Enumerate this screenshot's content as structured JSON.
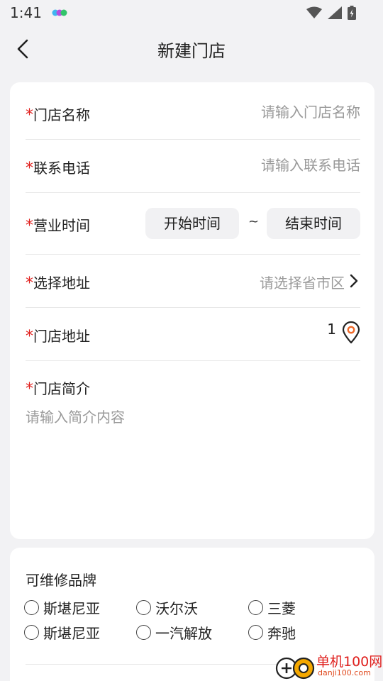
{
  "status_bar": {
    "time": "1:41"
  },
  "header": {
    "title": "新建门店",
    "back_icon": "chevron-left-icon"
  },
  "form": {
    "required_mark": "*",
    "store_name": {
      "label": "门店名称",
      "placeholder": "请输入门店名称",
      "value": ""
    },
    "phone": {
      "label": "联系电话",
      "placeholder": "请输入联系电话",
      "value": ""
    },
    "hours": {
      "label": "营业时间",
      "start": "开始时间",
      "separator": "~",
      "end": "结束时间"
    },
    "region": {
      "label": "选择地址",
      "placeholder": "请选择省市区",
      "icon": "chevron-right-icon"
    },
    "address": {
      "label": "门店地址",
      "value": "1",
      "icon": "location-pin-icon"
    },
    "intro": {
      "label": "门店简介",
      "placeholder": "请输入简介内容",
      "value": ""
    }
  },
  "brands": {
    "title": "可维修品牌",
    "items": [
      {
        "label": "斯堪尼亚",
        "checked": false
      },
      {
        "label": "沃尔沃",
        "checked": false
      },
      {
        "label": "三菱",
        "checked": false
      },
      {
        "label": "斯堪尼亚",
        "checked": false
      },
      {
        "label": "一汽解放",
        "checked": false
      },
      {
        "label": "奔驰",
        "checked": false
      }
    ]
  },
  "watermark": {
    "name": "单机100网",
    "url": "danji100.com"
  },
  "colors": {
    "required": "#e0201e",
    "pin_accent": "#f06a2a",
    "background": "#f2f2f4"
  }
}
